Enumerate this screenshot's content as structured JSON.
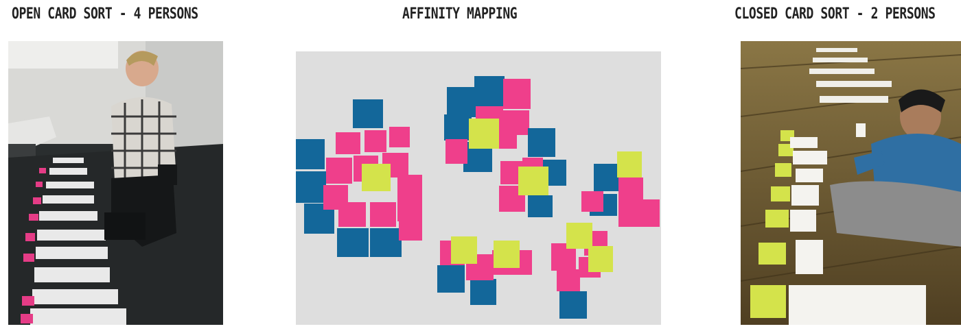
{
  "panels": [
    {
      "caption": "OPEN CARD SORT - 4 PERSONS"
    },
    {
      "caption": "AFFINITY MAPPING"
    },
    {
      "caption": "CLOSED CARD SORT - 2 PERSONS"
    }
  ],
  "colors": {
    "sticky_pink": "#ef3f8b",
    "sticky_blue": "#13679a",
    "sticky_yellow": "#d4e34b",
    "floor_dark": "#262a2b",
    "floor_wood": "#6e5a35",
    "wall": "#dfdfdf"
  }
}
